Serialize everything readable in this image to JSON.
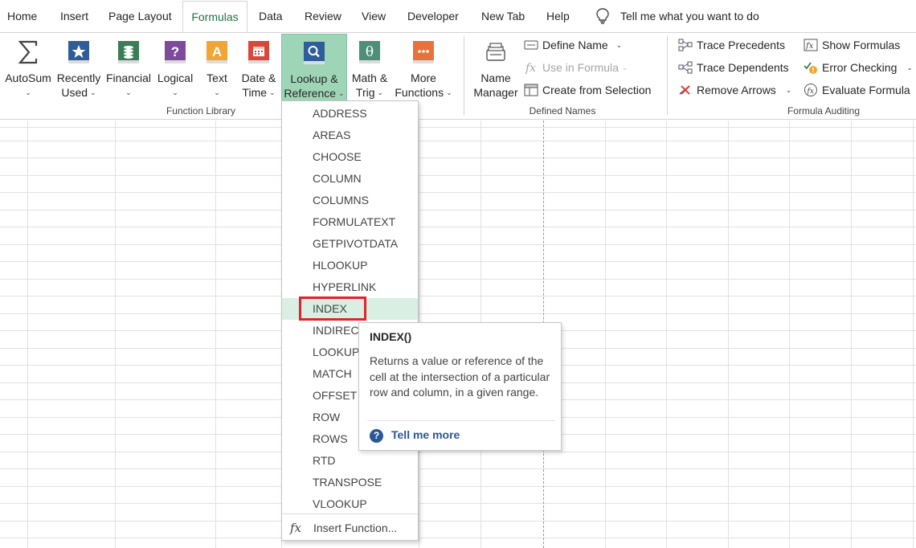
{
  "tabs": [
    {
      "label": "Home"
    },
    {
      "label": "Insert"
    },
    {
      "label": "Page Layout"
    },
    {
      "label": "Formulas",
      "active": true
    },
    {
      "label": "Data"
    },
    {
      "label": "Review"
    },
    {
      "label": "View"
    },
    {
      "label": "Developer"
    },
    {
      "label": "New Tab"
    },
    {
      "label": "Help"
    }
  ],
  "tell_me": {
    "text": "Tell me what you want to do",
    "icon": "lightbulb-icon"
  },
  "function_library": {
    "group_label": "Function Library",
    "buttons": [
      {
        "line1": "AutoSum",
        "line2": "",
        "icon": "sigma-icon"
      },
      {
        "line1": "Recently",
        "line2": "Used",
        "icon": "star-book-icon"
      },
      {
        "line1": "Financial",
        "line2": "",
        "icon": "financial-book-icon"
      },
      {
        "line1": "Logical",
        "line2": "",
        "icon": "question-book-icon"
      },
      {
        "line1": "Text",
        "line2": "",
        "icon": "text-book-icon"
      },
      {
        "line1": "Date &",
        "line2": "Time",
        "icon": "calendar-book-icon"
      },
      {
        "line1": "Lookup &",
        "line2": "Reference",
        "icon": "lookup-book-icon"
      },
      {
        "line1": "Math &",
        "line2": "Trig",
        "icon": "theta-book-icon"
      },
      {
        "line1": "More",
        "line2": "Functions",
        "icon": "more-book-icon"
      }
    ]
  },
  "defined_names": {
    "group_label": "Defined Names",
    "name_manager": {
      "line1": "Name",
      "line2": "Manager",
      "icon": "name-manager-icon"
    },
    "define_name": "Define Name",
    "use_in_formula": "Use in Formula",
    "create_from_selection": "Create from Selection"
  },
  "formula_auditing": {
    "group_label": "Formula Auditing",
    "trace_precedents": "Trace Precedents",
    "trace_dependents": "Trace Dependents",
    "remove_arrows": "Remove Arrows",
    "show_formulas": "Show Formulas",
    "error_checking": "Error Checking",
    "evaluate_formula": "Evaluate Formula"
  },
  "lookup_menu": {
    "items": [
      "ADDRESS",
      "AREAS",
      "CHOOSE",
      "COLUMN",
      "COLUMNS",
      "FORMULATEXT",
      "GETPIVOTDATA",
      "HLOOKUP",
      "HYPERLINK",
      "INDEX",
      "INDIRECT",
      "LOOKUP",
      "MATCH",
      "OFFSET",
      "ROW",
      "ROWS",
      "RTD",
      "TRANSPOSE",
      "VLOOKUP"
    ],
    "highlighted": "INDEX",
    "insert_function": "Insert Function..."
  },
  "tooltip": {
    "title": "INDEX()",
    "description": "Returns a value or reference of the cell at the intersection of a particular row and column, in a given range.",
    "link": "Tell me more"
  },
  "colors": {
    "accent": "#217346",
    "highlight_border": "#e0242a",
    "pressed": "#9fd5b7",
    "hover": "#d9efe3"
  }
}
